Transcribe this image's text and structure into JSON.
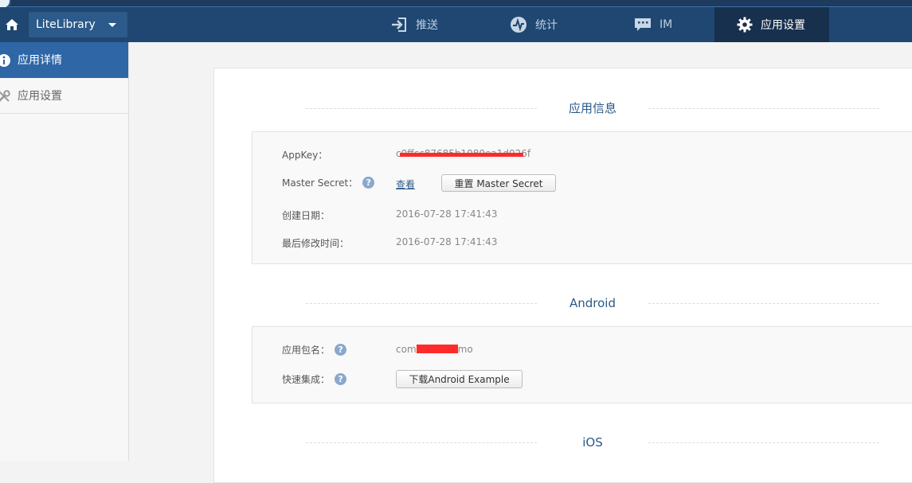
{
  "header": {
    "app_name": "LiteLibrary",
    "nav": [
      {
        "label": "推送",
        "icon": "push-icon"
      },
      {
        "label": "统计",
        "icon": "stats-icon"
      },
      {
        "label": "IM",
        "icon": "chat-icon"
      },
      {
        "label": "应用设置",
        "icon": "gear-icon"
      }
    ],
    "active_nav": "应用设置"
  },
  "sidebar": {
    "items": [
      {
        "label": "应用详情",
        "icon": "info-icon",
        "active": true
      },
      {
        "label": "应用设置",
        "icon": "tools-icon",
        "active": false
      }
    ]
  },
  "app_info": {
    "title": "应用信息",
    "appkey_label": "AppKey：",
    "appkey_value": "c0ffcc87685b1080ea1d026f",
    "master_secret_label": "Master Secret：",
    "view_link": "查看",
    "reset_button": "重置 Master Secret",
    "created_label": "创建日期：",
    "created_value": "2016-07-28 17:41:43",
    "modified_label": "最后修改时间：",
    "modified_value": "2016-07-28 17:41:43"
  },
  "android": {
    "title": "Android",
    "package_label": "应用包名：",
    "package_value_prefix": "com",
    "package_value_suffix": "mo",
    "quick_label": "快速集成：",
    "download_button": "下载Android Example"
  },
  "ios": {
    "title": "iOS"
  },
  "colors": {
    "topbar": "#1f4772",
    "active_nav": "#17304d",
    "sidebar_active": "#2e66a6",
    "accent_text": "#2c5a86",
    "redaction": "#ff2a2a"
  }
}
